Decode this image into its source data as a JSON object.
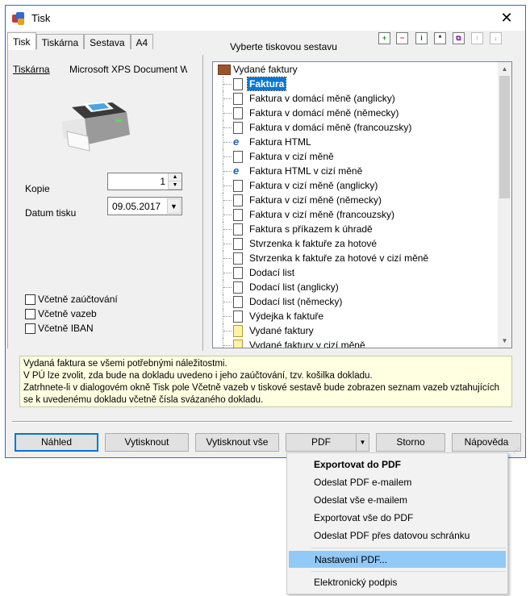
{
  "window": {
    "title": "Tisk",
    "close_glyph": "✕"
  },
  "tabs": [
    "Tisk",
    "Tiskárna",
    "Sestava",
    "A4"
  ],
  "left": {
    "printer_label": "Tiskárna",
    "printer_name": "Microsoft XPS Document Writer",
    "copies_label": "Kopie",
    "copies_value": "1",
    "date_label": "Datum tisku",
    "date_value": "09.05.2017",
    "checkboxes": [
      "Včetně zaúčtování",
      "Včetně vazeb",
      "Včetně IBAN"
    ]
  },
  "right": {
    "header": "Vyberte tiskovou sestavu",
    "toolbar_icons": [
      "add-icon",
      "remove-icon",
      "info-icon",
      "star-icon",
      "copy-icon",
      "move-up-icon",
      "move-down-icon"
    ],
    "tree_root": "Vydané faktury",
    "tree_items": [
      {
        "label": "Faktura",
        "icon": "doc-icon",
        "selected": true
      },
      {
        "label": "Faktura v domácí měně (anglicky)",
        "icon": "doc-icon"
      },
      {
        "label": "Faktura v domácí měně (německy)",
        "icon": "doc-icon"
      },
      {
        "label": "Faktura v domácí měně (francouzsky)",
        "icon": "doc-icon"
      },
      {
        "label": "Faktura HTML",
        "icon": "ie-icon"
      },
      {
        "label": "Faktura v cizí měně",
        "icon": "doc-icon"
      },
      {
        "label": "Faktura HTML v cizí měně",
        "icon": "ie-icon"
      },
      {
        "label": "Faktura v cizí měně (anglicky)",
        "icon": "doc-icon"
      },
      {
        "label": "Faktura v cizí měně (německy)",
        "icon": "doc-icon"
      },
      {
        "label": "Faktura v cizí měně (francouzsky)",
        "icon": "doc-icon"
      },
      {
        "label": "Faktura s příkazem k úhradě",
        "icon": "doc-icon"
      },
      {
        "label": "Stvrzenka k faktuře za hotové",
        "icon": "doc-icon"
      },
      {
        "label": "Stvrzenka k faktuře za hotové v cizí měně",
        "icon": "doc-icon"
      },
      {
        "label": "Dodací list",
        "icon": "doc-icon"
      },
      {
        "label": "Dodací list (anglicky)",
        "icon": "doc-icon"
      },
      {
        "label": "Dodací list (německy)",
        "icon": "doc-icon"
      },
      {
        "label": "Výdejka k faktuře",
        "icon": "doc-icon"
      },
      {
        "label": "Vydané faktury",
        "icon": "doc-yellow-icon"
      },
      {
        "label": "Vydané faktury v cizí měně",
        "icon": "doc-yellow-icon"
      }
    ]
  },
  "description": [
    "Vydaná faktura se všemi potřebnými náležitostmi.",
    "V PÚ lze zvolit, zda bude na dokladu uvedeno i jeho zaúčtování, tzv. košilka dokladu.",
    "Zatrhnete-li v dialogovém okně Tisk pole Včetně vazeb v tiskové sestavě bude zobrazen seznam vazeb vztahujících",
    "se k uvedenému dokladu včetně čísla svázaného dokladu."
  ],
  "buttons": {
    "preview": "Náhled",
    "print": "Vytisknout",
    "print_all": "Vytisknout vše",
    "pdf": "PDF",
    "cancel": "Storno",
    "help": "Nápověda"
  },
  "pdf_menu": [
    "Exportovat do PDF",
    "Odeslat PDF e-mailem",
    "Odeslat vše e-mailem",
    "Exportovat vše do PDF",
    "Odeslat PDF přes datovou schránku",
    "Nastavení PDF...",
    "Elektronický podpis"
  ]
}
